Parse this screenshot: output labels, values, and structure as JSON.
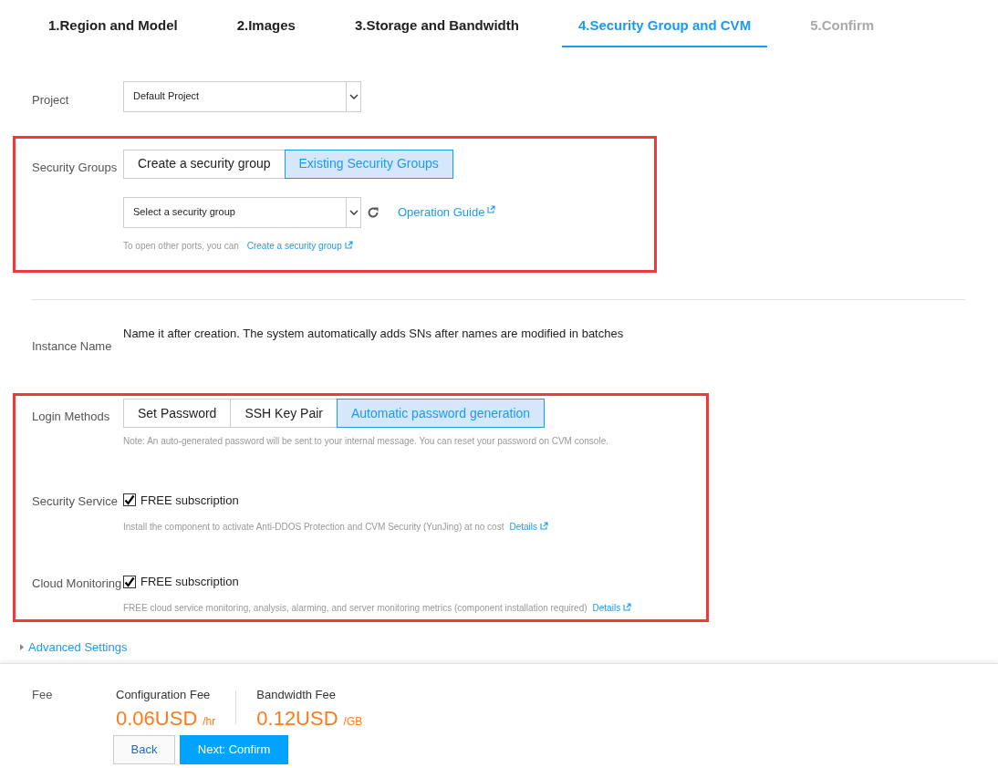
{
  "steps": [
    {
      "label": "1.Region and Model",
      "selected": false,
      "disabled": false
    },
    {
      "label": "2.Images",
      "selected": false,
      "disabled": false
    },
    {
      "label": "3.Storage and Bandwidth",
      "selected": false,
      "disabled": false
    },
    {
      "label": "4.Security Group and CVM",
      "selected": true,
      "disabled": false
    },
    {
      "label": "5.Confirm",
      "selected": false,
      "disabled": true
    }
  ],
  "project": {
    "label": "Project",
    "value": "Default Project"
  },
  "security_groups": {
    "label": "Security Groups",
    "options": [
      {
        "label": "Create a security group",
        "selected": false
      },
      {
        "label": "Existing Security Groups",
        "selected": true
      }
    ],
    "select_value": "Select a security group",
    "guide_link": "Operation Guide",
    "hint": "To open other ports, you can",
    "hint_link": "Create a security group"
  },
  "instance_name": {
    "label": "Instance Name",
    "text": "Name it after creation. The system automatically adds SNs after names are modified in batches"
  },
  "login_methods": {
    "label": "Login Methods",
    "options": [
      {
        "label": "Set Password",
        "selected": false
      },
      {
        "label": "SSH Key Pair",
        "selected": false
      },
      {
        "label": "Automatic password generation",
        "selected": true
      }
    ],
    "note": "Note: An auto-generated password will be sent to your internal message. You can reset your password on CVM console."
  },
  "services": [
    {
      "label": "Security Service",
      "checkbox": "FREE subscription",
      "checked": true,
      "description": "Install the component to activate Anti-DDOS Protection and CVM Security (YunJing) at no cost",
      "link": "Details"
    },
    {
      "label": "Cloud Monitoring",
      "checkbox": "FREE subscription",
      "checked": true,
      "description": "FREE cloud service monitoring, analysis, alarming, and server monitoring metrics (component installation required)",
      "link": "Details"
    }
  ],
  "advanced_settings": "Advanced Settings",
  "fee": {
    "label": "Fee",
    "items": [
      {
        "label": "Configuration Fee",
        "amount": "0.06USD",
        "unit": "/hr"
      },
      {
        "label": "Bandwidth Fee",
        "amount": "0.12USD",
        "unit": "/GB"
      }
    ]
  },
  "buttons": [
    {
      "label": "Back",
      "kind": "secondary"
    },
    {
      "label": "Next: Confirm",
      "kind": "primary"
    }
  ]
}
